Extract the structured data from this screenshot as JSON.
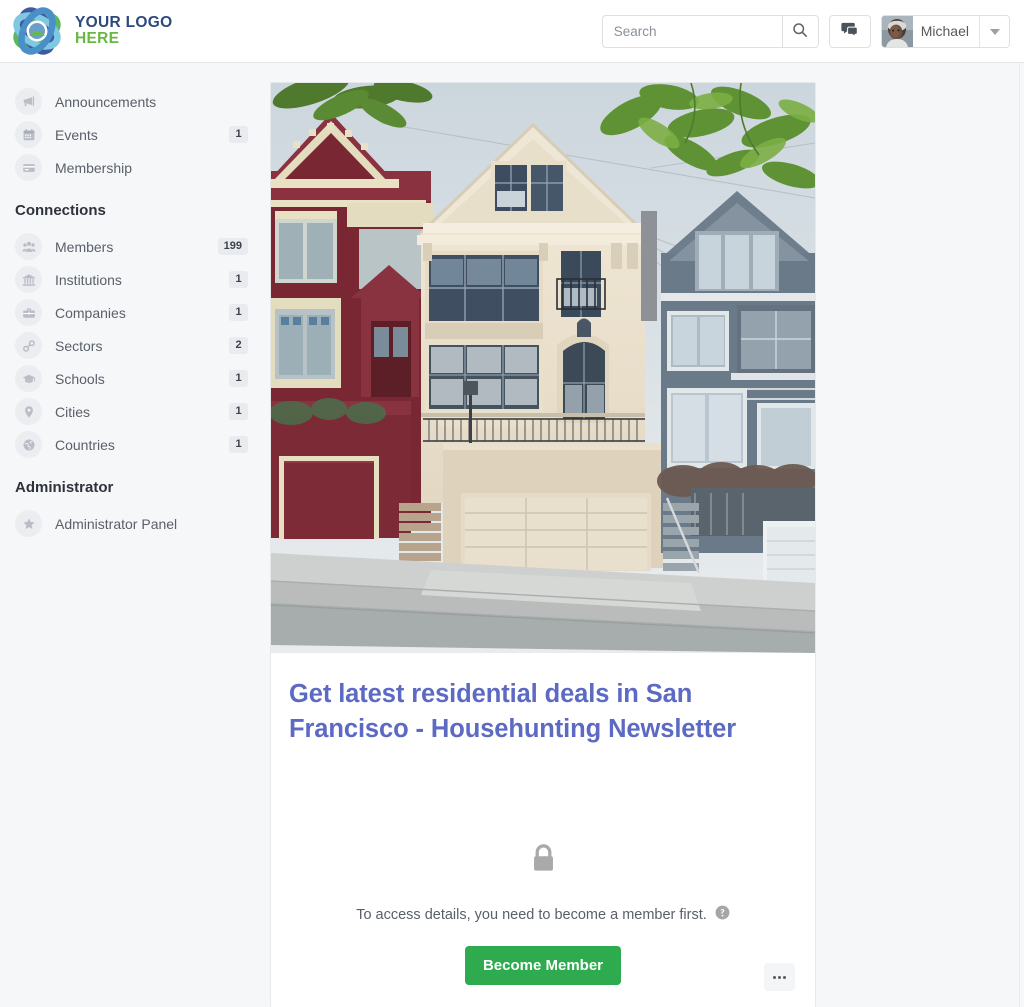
{
  "header": {
    "brand_line1": "YOUR LOGO",
    "brand_line2": "HERE",
    "logo_icon": "interlocking-rings-logo",
    "search": {
      "placeholder": "Search",
      "value": "",
      "button_icon": "search-icon"
    },
    "messages_icon": "chat-bubbles-icon",
    "user": {
      "name": "Michael",
      "avatar_icon": "user-avatar-photo",
      "caret_icon": "caret-down-icon"
    }
  },
  "sidebar": {
    "primary_items": [
      {
        "label": "Announcements",
        "icon": "megaphone-icon",
        "badge": ""
      },
      {
        "label": "Events",
        "icon": "calendar-icon",
        "badge": "1"
      },
      {
        "label": "Membership",
        "icon": "membership-card-icon",
        "badge": ""
      }
    ],
    "connections_title": "Connections",
    "connections_items": [
      {
        "label": "Members",
        "icon": "people-group-icon",
        "badge": "199"
      },
      {
        "label": "Institutions",
        "icon": "bank-icon",
        "badge": "1"
      },
      {
        "label": "Companies",
        "icon": "briefcase-icon",
        "badge": "1"
      },
      {
        "label": "Sectors",
        "icon": "link-chain-icon",
        "badge": "2"
      },
      {
        "label": "Schools",
        "icon": "graduation-cap-icon",
        "badge": "1"
      },
      {
        "label": "Cities",
        "icon": "map-pin-icon",
        "badge": "1"
      },
      {
        "label": "Countries",
        "icon": "globe-icon",
        "badge": "1"
      }
    ],
    "administrator_title": "Administrator",
    "administrator_items": [
      {
        "label": "Administrator Panel",
        "icon": "star-icon",
        "badge": ""
      }
    ]
  },
  "card": {
    "photo_alt": "san-francisco-victorian-houses-photo",
    "title": "Get latest residential deals in San Francisco - Househunting Newsletter",
    "lock_icon": "padlock-closed-icon",
    "locked_message": "To access details, you need to become a member first.",
    "help_icon": "help-circle-icon",
    "cta_label": "Become Member",
    "more_icon": "ellipsis-icon"
  },
  "colors": {
    "accent_title": "#5c6ac4",
    "cta_green": "#2eab4f",
    "brand_blue": "#2b4a7e",
    "brand_green": "#6bb745",
    "page_bg": "#f6f7f9"
  }
}
